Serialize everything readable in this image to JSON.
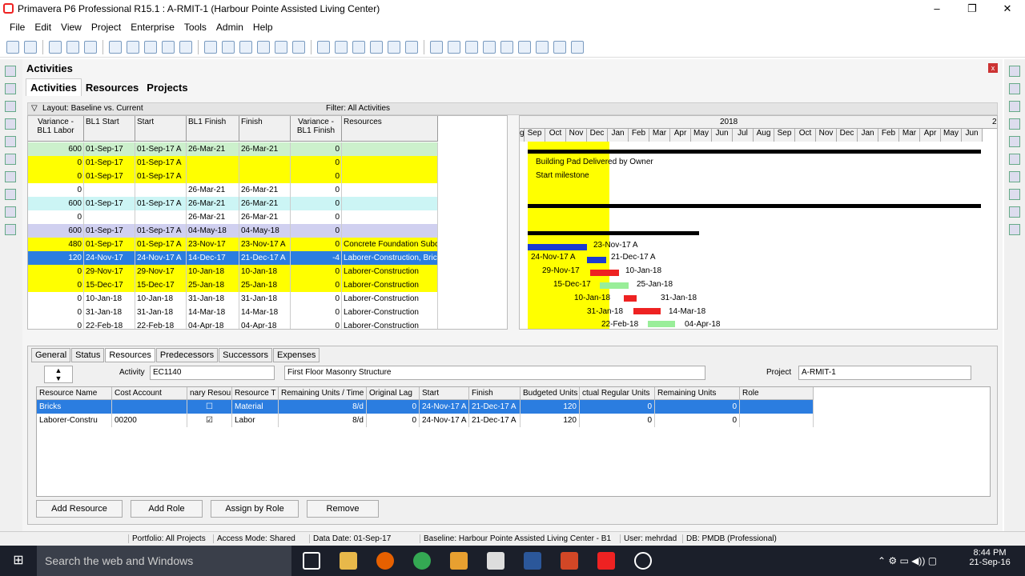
{
  "window": {
    "title": "Primavera P6 Professional R15.1 : A-RMIT-1 (Harbour Pointe Assisted Living Center)",
    "min": "–",
    "max": "❐",
    "close": "✕"
  },
  "menu": [
    "File",
    "Edit",
    "View",
    "Project",
    "Enterprise",
    "Tools",
    "Admin",
    "Help"
  ],
  "panel": {
    "title": "Activities",
    "close": "x",
    "tabs": [
      "Activities",
      "Resources",
      "Projects"
    ],
    "layout": "Layout: Baseline vs. Current",
    "filter": "Filter: All Activities"
  },
  "grid": {
    "headers": [
      "Variance - BL1 Labor",
      "BL1 Start",
      "Start",
      "BL1 Finish",
      "Finish",
      "Variance - BL1 Finish",
      "Resources"
    ],
    "rows": [
      [
        "600",
        "01-Sep-17",
        "01-Sep-17 A",
        "26-Mar-21",
        "26-Mar-21",
        "0",
        ""
      ],
      [
        "0",
        "01-Sep-17",
        "01-Sep-17 A",
        "",
        "",
        "0",
        ""
      ],
      [
        "0",
        "01-Sep-17",
        "01-Sep-17 A",
        "",
        "",
        "0",
        ""
      ],
      [
        "0",
        "",
        "",
        "26-Mar-21",
        "26-Mar-21",
        "0",
        ""
      ],
      [
        "600",
        "01-Sep-17",
        "01-Sep-17 A",
        "26-Mar-21",
        "26-Mar-21",
        "0",
        ""
      ],
      [
        "0",
        "",
        "",
        "26-Mar-21",
        "26-Mar-21",
        "0",
        ""
      ],
      [
        "600",
        "01-Sep-17",
        "01-Sep-17 A",
        "04-May-18",
        "04-May-18",
        "0",
        ""
      ],
      [
        "480",
        "01-Sep-17",
        "01-Sep-17 A",
        "23-Nov-17",
        "23-Nov-17 A",
        "0",
        "Concrete Foundation Subc"
      ],
      [
        "120",
        "24-Nov-17",
        "24-Nov-17 A",
        "14-Dec-17",
        "21-Dec-17 A",
        "-4",
        "Laborer-Construction, Brick"
      ],
      [
        "0",
        "29-Nov-17",
        "29-Nov-17",
        "10-Jan-18",
        "10-Jan-18",
        "0",
        "Laborer-Construction"
      ],
      [
        "0",
        "15-Dec-17",
        "15-Dec-17",
        "25-Jan-18",
        "25-Jan-18",
        "0",
        "Laborer-Construction"
      ],
      [
        "0",
        "10-Jan-18",
        "10-Jan-18",
        "31-Jan-18",
        "31-Jan-18",
        "0",
        "Laborer-Construction"
      ],
      [
        "0",
        "31-Jan-18",
        "31-Jan-18",
        "14-Mar-18",
        "14-Mar-18",
        "0",
        "Laborer-Construction"
      ],
      [
        "0",
        "22-Feb-18",
        "22-Feb-18",
        "04-Apr-18",
        "04-Apr-18",
        "0",
        "Laborer-Construction"
      ]
    ],
    "row_colors": [
      "#ccf0cc",
      "#ffff00",
      "#ffff00",
      "#ffffff",
      "#ccf5f5",
      "#ffffff",
      "#d0d0f0",
      "#ffff00",
      "#2b7de0",
      "#ffff00",
      "#ffff00",
      "#ffffff",
      "#ffffff",
      "#ffffff"
    ]
  },
  "gantt": {
    "year": "2018",
    "year_next": "2",
    "months": [
      "g",
      "Sep",
      "Oct",
      "Nov",
      "Dec",
      "Jan",
      "Feb",
      "Mar",
      "Apr",
      "May",
      "Jun",
      "Jul",
      "Aug",
      "Sep",
      "Oct",
      "Nov",
      "Dec",
      "Jan",
      "Feb",
      "Mar",
      "Apr",
      "May",
      "Jun"
    ],
    "labels": [
      "Building Pad Delivered by Owner",
      "Start milestone",
      "23-Nov-17 A",
      "24-Nov-17 A",
      "21-Dec-17 A",
      "29-Nov-17",
      "10-Jan-18",
      "15-Dec-17",
      "25-Jan-18",
      "10-Jan-18",
      "31-Jan-18",
      "31-Jan-18",
      "14-Mar-18",
      "22-Feb-18",
      "04-Apr-18"
    ]
  },
  "detail": {
    "tabs": [
      "General",
      "Status",
      "Resources",
      "Predecessors",
      "Successors",
      "Expenses"
    ],
    "activity_label": "Activity",
    "activity_id": "EC1140",
    "activity_name": "First Floor Masonry Structure",
    "project_label": "Project",
    "project_id": "A-RMIT-1",
    "headers": [
      "Resource Name",
      "Cost Account",
      "nary Resou",
      "Resource T",
      "Remaining Units / Time",
      "Original Lag",
      "Start",
      "Finish",
      "Budgeted Units",
      "ctual Regular Units",
      "Remaining Units",
      "Role"
    ],
    "rows": [
      [
        "Bricks",
        "",
        "☐",
        "Material",
        "8/d",
        "0",
        "24-Nov-17 A",
        "21-Dec-17 A",
        "120",
        "0",
        "0",
        ""
      ],
      [
        "Laborer-Constru",
        "00200",
        "☑",
        "Labor",
        "8/d",
        "0",
        "24-Nov-17 A",
        "21-Dec-17 A",
        "120",
        "0",
        "0",
        ""
      ]
    ],
    "buttons": [
      "Add Resource",
      "Add Role",
      "Assign by Role",
      "Remove"
    ]
  },
  "status": [
    "Portfolio: All Projects",
    "Access Mode: Shared",
    "Data Date: 01-Sep-17",
    "Baseline: Harbour Pointe Assisted Living Center - B1",
    "User: mehrdad",
    "DB: PMDB (Professional)"
  ],
  "taskbar": {
    "search": "Search the web and Windows",
    "time": "8:44 PM",
    "date": "21-Sep-16"
  }
}
